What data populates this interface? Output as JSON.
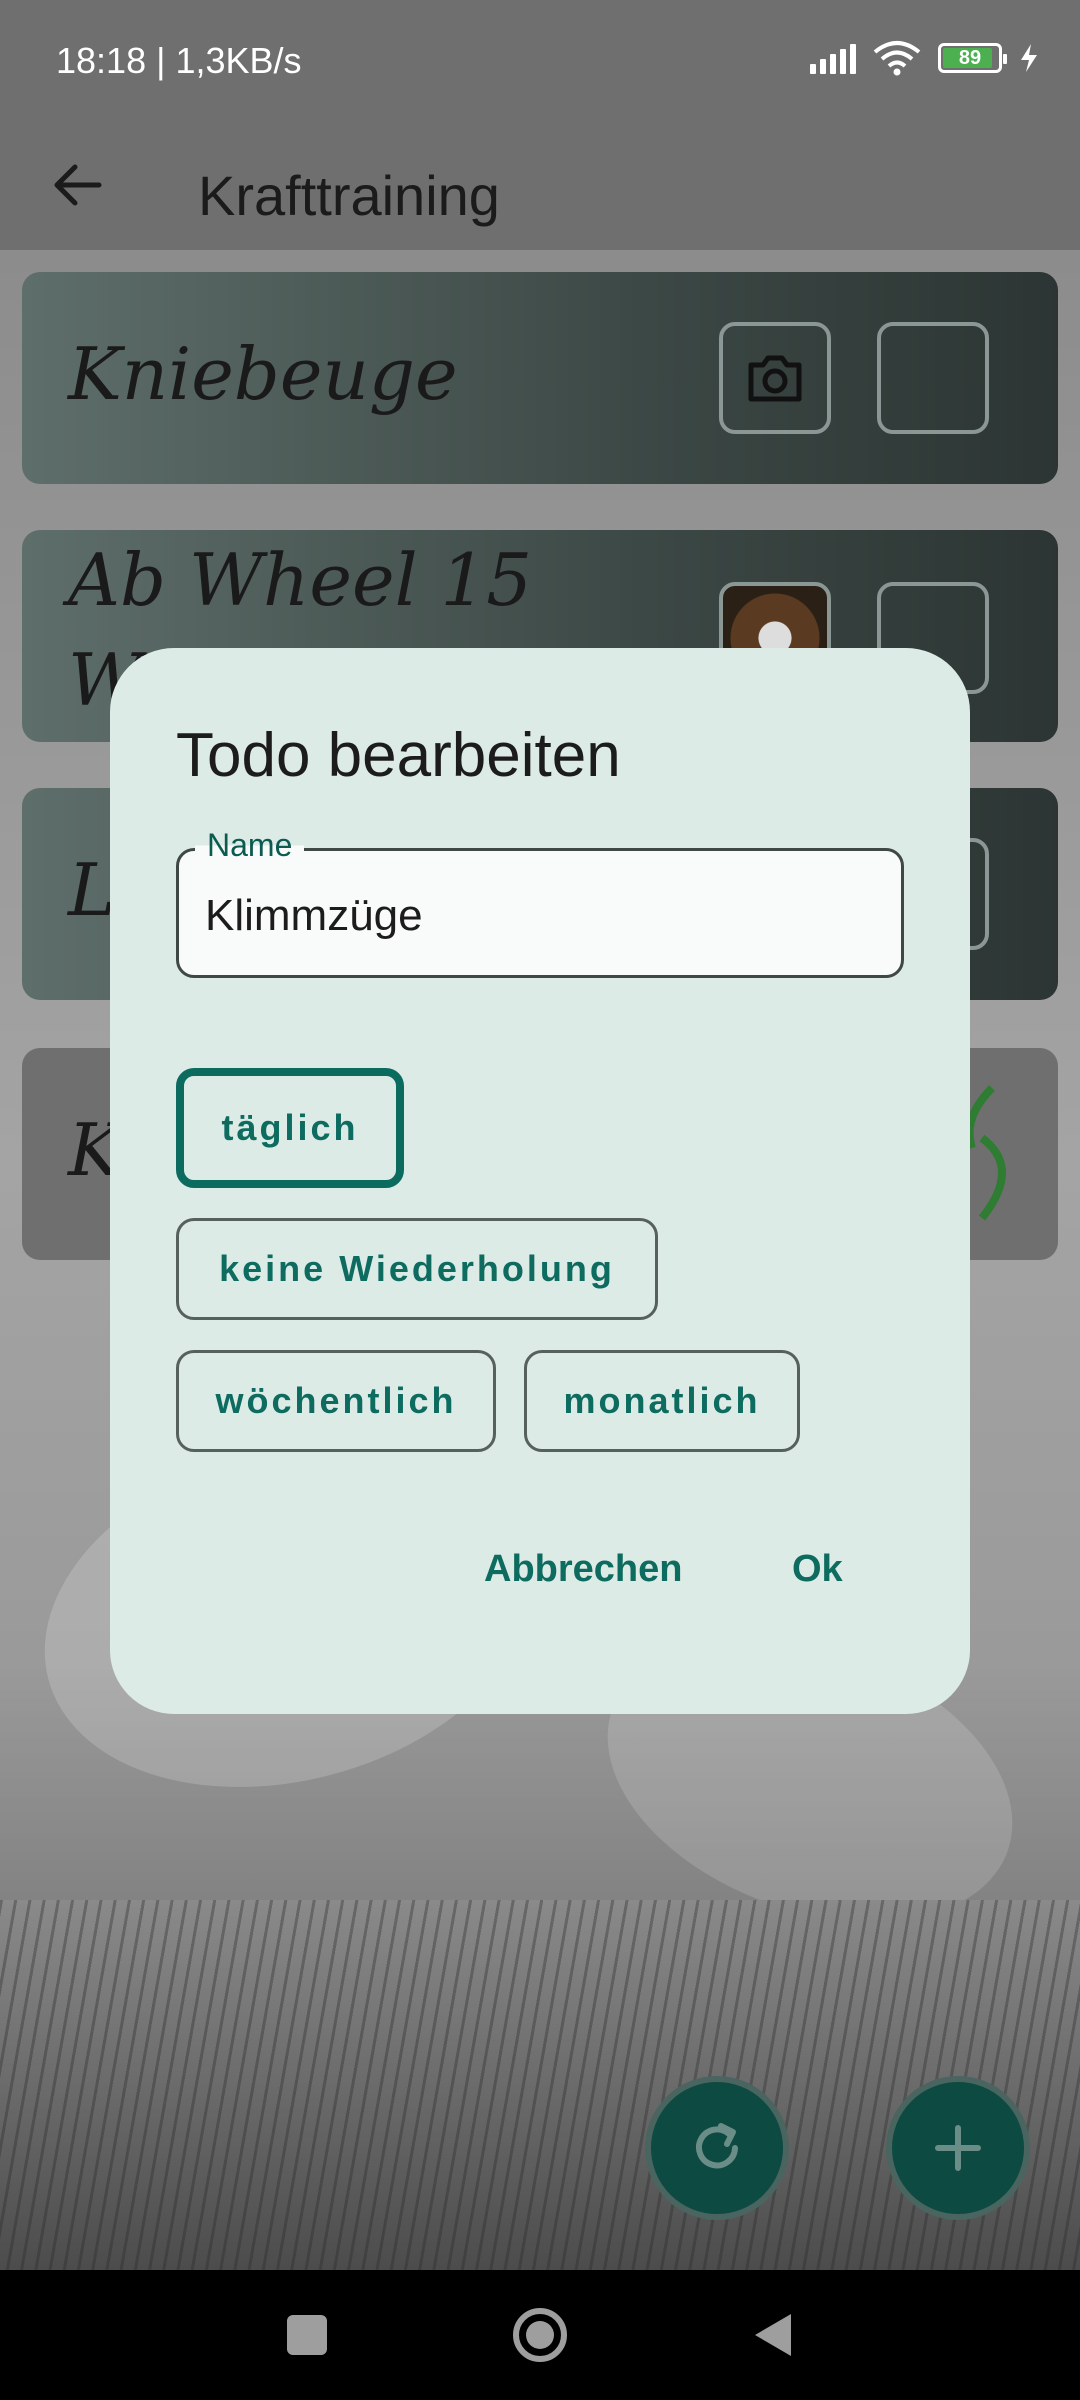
{
  "status": {
    "time_speed": "18:18 | 1,3KB/s",
    "battery": "89"
  },
  "app_bar": {
    "title": "Krafttraining"
  },
  "cards": [
    {
      "title": "Kniebeuge"
    },
    {
      "title_line1": "Ab Wheel 15",
      "title_line2": "W"
    },
    {
      "title": "L"
    },
    {
      "title": "K"
    }
  ],
  "dialog": {
    "title": "Todo bearbeiten",
    "name_label": "Name",
    "name_value": "Klimmzüge",
    "chips": [
      "täglich",
      "keine Wiederholung",
      "wöchentlich",
      "monatlich"
    ],
    "selected_chip": "täglich",
    "cancel": "Abbrechen",
    "ok": "Ok"
  },
  "icons": [
    "back-arrow-icon",
    "camera-icon",
    "refresh-icon",
    "add-icon",
    "nav-recents-icon",
    "nav-home-icon",
    "nav-back-icon"
  ],
  "colors": {
    "accent": "#0d6b5f",
    "dialog_bg": "#dcebe6",
    "fab_bg": "#0d4a42"
  }
}
